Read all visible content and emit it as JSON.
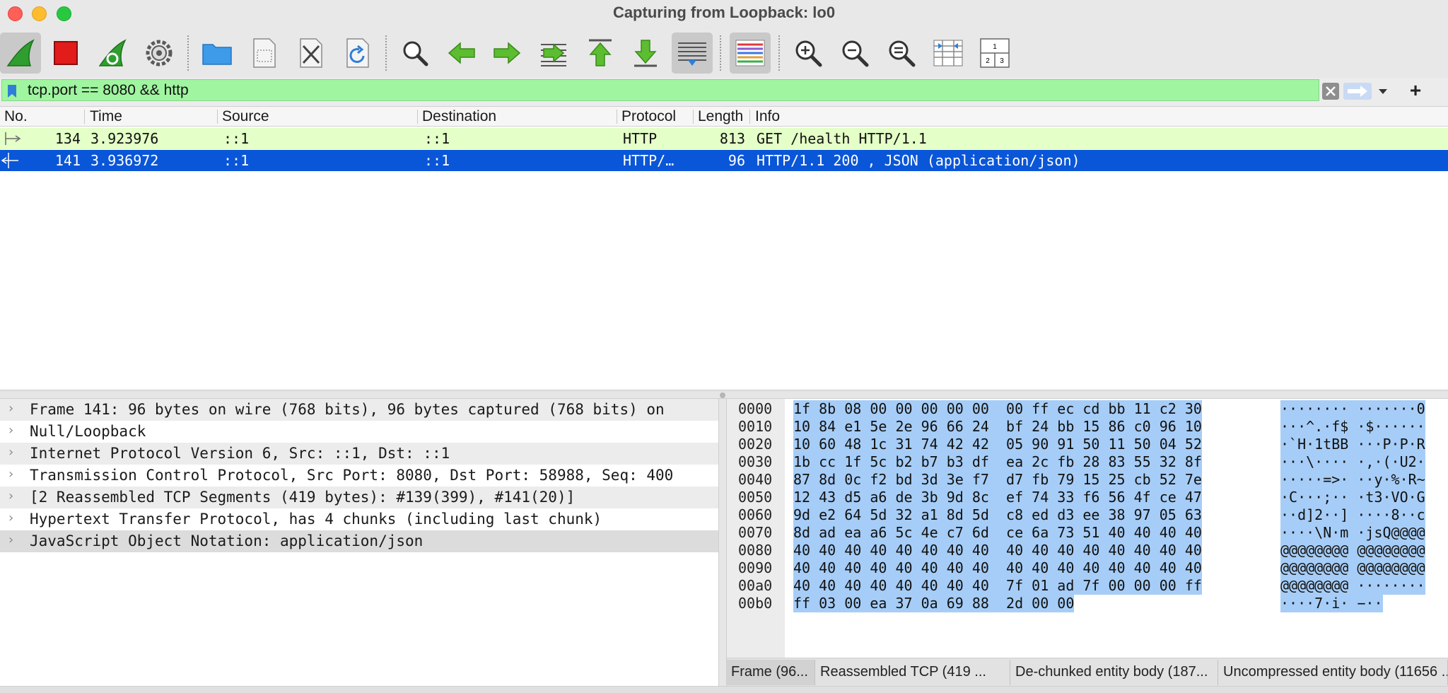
{
  "window": {
    "title": "Capturing from Loopback: lo0"
  },
  "toolbar": {
    "buttons": [
      {
        "icon": "shark-fin-start-icon",
        "active": true
      },
      {
        "icon": "stop-square-icon"
      },
      {
        "icon": "restart-fin-icon"
      },
      {
        "icon": "capture-options-gear-icon"
      },
      {
        "icon": "open-folder-icon"
      },
      {
        "icon": "save-file-icon"
      },
      {
        "icon": "close-file-icon"
      },
      {
        "icon": "reload-file-icon"
      },
      {
        "icon": "find-packet-icon"
      },
      {
        "icon": "go-back-arrow-icon"
      },
      {
        "icon": "go-forward-arrow-icon"
      },
      {
        "icon": "go-to-packet-icon"
      },
      {
        "icon": "first-packet-icon"
      },
      {
        "icon": "last-packet-icon"
      },
      {
        "icon": "auto-scroll-icon",
        "active": true
      },
      {
        "icon": "colorize-icon",
        "active": true
      },
      {
        "icon": "zoom-in-icon"
      },
      {
        "icon": "zoom-out-icon"
      },
      {
        "icon": "normal-size-icon"
      },
      {
        "icon": "resize-columns-icon"
      },
      {
        "icon": "layout-panes-icon"
      }
    ]
  },
  "filter": {
    "value": "tcp.port == 8080 && http",
    "add_label": "+"
  },
  "packet_list": {
    "columns": [
      "No.",
      "Time",
      "Source",
      "Destination",
      "Protocol",
      "Length",
      "Info"
    ],
    "rows": [
      {
        "no": "134",
        "time": "3.923976",
        "source": "::1",
        "destination": "::1",
        "protocol": "HTTP",
        "length": "813",
        "info": "GET /health HTTP/1.1"
      },
      {
        "no": "141",
        "time": "3.936972",
        "source": "::1",
        "destination": "::1",
        "protocol": "HTTP/…",
        "length": "96",
        "info": "HTTP/1.1 200  , JSON (application/json)"
      }
    ],
    "colors": {
      "request_row": "#e4ffc7",
      "selected_row": "#0a56d8"
    }
  },
  "details": {
    "items": [
      "Frame 141: 96 bytes on wire (768 bits), 96 bytes captured (768 bits) on",
      "Null/Loopback",
      "Internet Protocol Version 6, Src: ::1, Dst: ::1",
      "Transmission Control Protocol, Src Port: 8080, Dst Port: 58988, Seq: 400",
      "[2 Reassembled TCP Segments (419 bytes): #139(399), #141(20)]",
      "Hypertext Transfer Protocol, has 4 chunks (including last chunk)",
      "JavaScript Object Notation: application/json"
    ]
  },
  "bytes": {
    "rows": [
      {
        "offset": "0000",
        "hex": "1f 8b 08 00 00 00 00 00  00 ff ec cd bb 11 c2 30",
        "ascii": "········ ·······0"
      },
      {
        "offset": "0010",
        "hex": "10 84 e1 5e 2e 96 66 24  bf 24 bb 15 86 c0 96 10",
        "ascii": "···^.·f$ ·$······"
      },
      {
        "offset": "0020",
        "hex": "10 60 48 1c 31 74 42 42  05 90 91 50 11 50 04 52",
        "ascii": "·`H·1tBB ···P·P·R"
      },
      {
        "offset": "0030",
        "hex": "1b cc 1f 5c b2 b7 b3 df  ea 2c fb 28 83 55 32 8f",
        "ascii": "···\\···· ·,·(·U2·"
      },
      {
        "offset": "0040",
        "hex": "87 8d 0c f2 bd 3d 3e f7  d7 fb 79 15 25 cb 52 7e",
        "ascii": "·····=>· ··y·%·R~"
      },
      {
        "offset": "0050",
        "hex": "12 43 d5 a6 de 3b 9d 8c  ef 74 33 f6 56 4f ce 47",
        "ascii": "·C···;·· ·t3·VO·G"
      },
      {
        "offset": "0060",
        "hex": "9d e2 64 5d 32 a1 8d 5d  c8 ed d3 ee 38 97 05 63",
        "ascii": "··d]2··] ····8··c"
      },
      {
        "offset": "0070",
        "hex": "8d ad ea a6 5c 4e c7 6d  ce 6a 73 51 40 40 40 40",
        "ascii": "····\\N·m ·jsQ@@@@"
      },
      {
        "offset": "0080",
        "hex": "40 40 40 40 40 40 40 40  40 40 40 40 40 40 40 40",
        "ascii": "@@@@@@@@ @@@@@@@@"
      },
      {
        "offset": "0090",
        "hex": "40 40 40 40 40 40 40 40  40 40 40 40 40 40 40 40",
        "ascii": "@@@@@@@@ @@@@@@@@"
      },
      {
        "offset": "00a0",
        "hex": "40 40 40 40 40 40 40 40  7f 01 ad 7f 00 00 00 ff",
        "ascii": "@@@@@@@@ ········"
      },
      {
        "offset": "00b0",
        "hex": "ff 03 00 ea 37 0a 69 88  2d 00 00",
        "ascii": "····7·i· −··"
      }
    ],
    "highlight_color": "#a6cdf7",
    "tabs": [
      "Frame (96...",
      "Reassembled TCP (419 ...",
      "De-chunked entity body (187...",
      "Uncompressed entity body (11656 ..."
    ]
  }
}
